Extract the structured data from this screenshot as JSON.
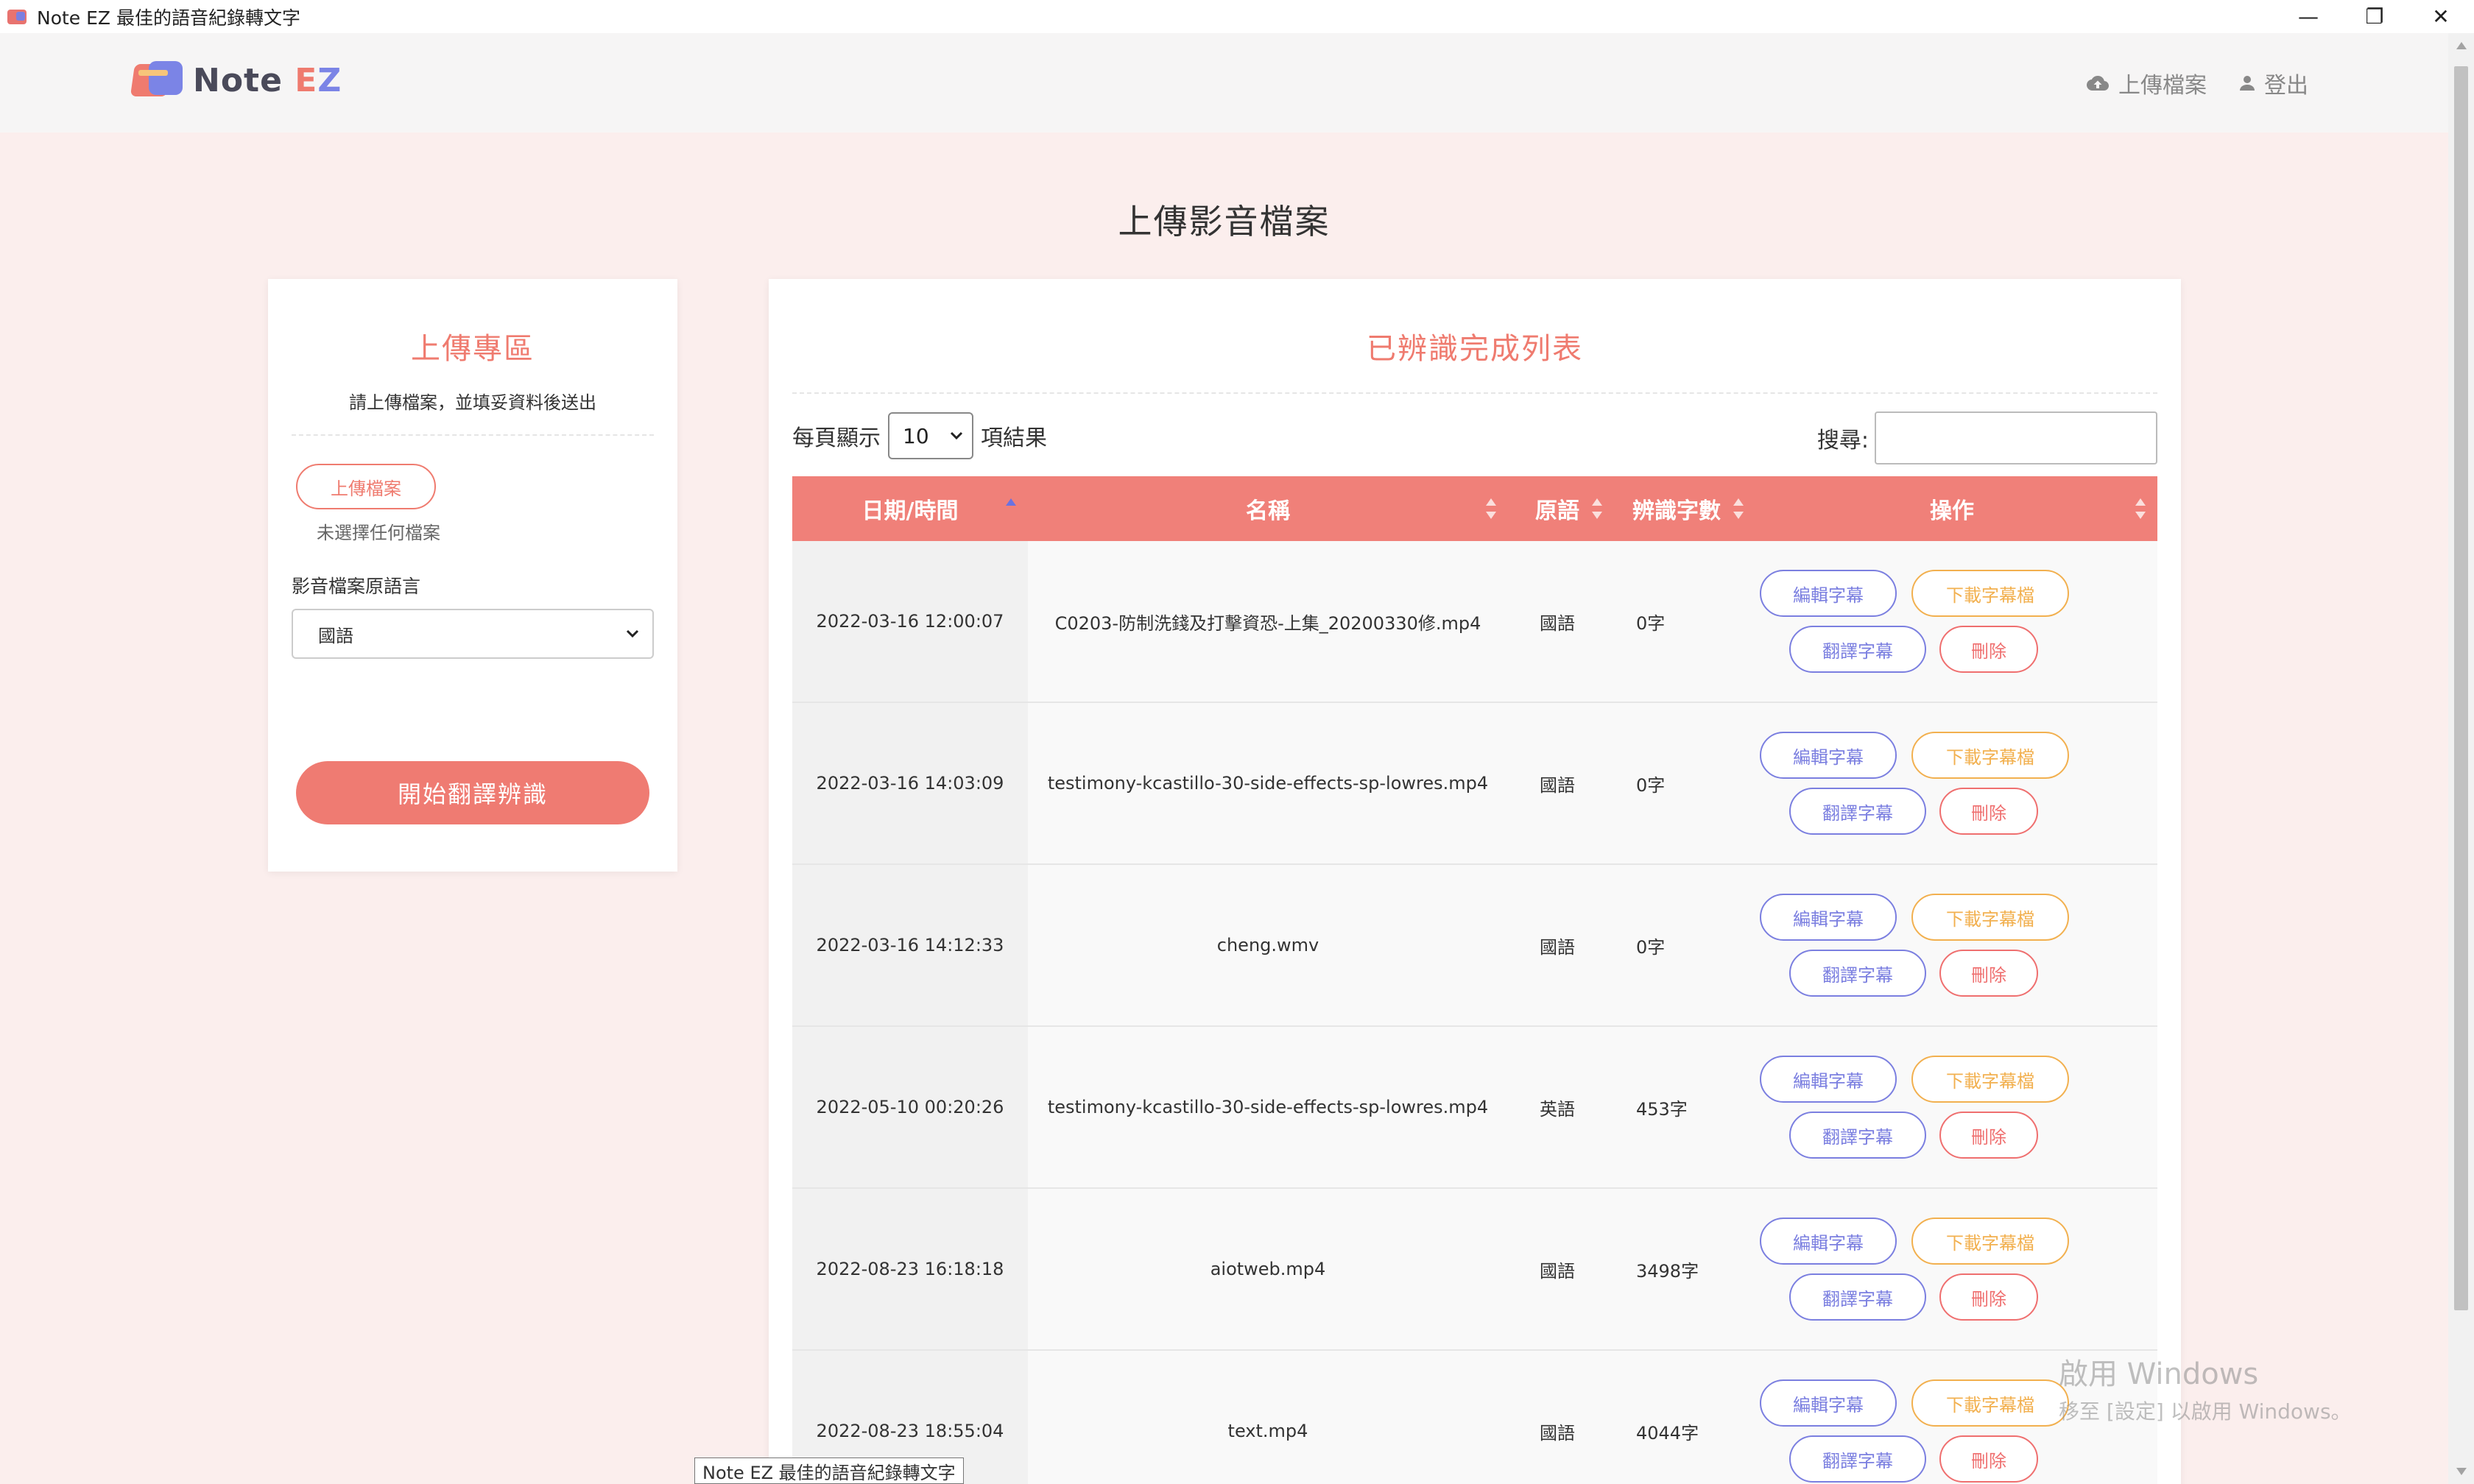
{
  "window": {
    "title": "Note EZ 最佳的語音紀錄轉文字",
    "minimize": "—",
    "restore": "❐",
    "close": "✕"
  },
  "header": {
    "logo_text_note": "Note ",
    "logo_text_e": "E",
    "logo_text_z": "Z",
    "nav": {
      "upload": "上傳檔案",
      "logout": "登出"
    }
  },
  "page": {
    "title": "上傳影音檔案"
  },
  "upload_panel": {
    "title": "上傳專區",
    "subtitle": "請上傳檔案，並填妥資料後送出",
    "upload_button": "上傳檔案",
    "no_file": "未選擇任何檔案",
    "language_label": "影音檔案原語言",
    "language_selected": "國語",
    "start_button": "開始翻譯辨識"
  },
  "list_panel": {
    "title": "已辨識完成列表",
    "per_page_prefix": "每頁顯示",
    "per_page_value": "10",
    "per_page_suffix": "項結果",
    "search_label": "搜尋:",
    "columns": {
      "date": "日期/時間",
      "name": "名稱",
      "lang": "原語",
      "count": "辨識字數",
      "ops": "操作"
    },
    "buttons": {
      "edit": "編輯字幕",
      "download": "下載字幕檔",
      "translate": "翻譯字幕",
      "delete": "刪除"
    },
    "rows": [
      {
        "date": "2022-03-16 12:00:07",
        "name": "C0203-防制洗錢及打擊資恐-上集_20200330修.mp4",
        "lang": "國語",
        "count": "0字"
      },
      {
        "date": "2022-03-16 14:03:09",
        "name": "testimony-kcastillo-30-side-effects-sp-lowres.mp4",
        "lang": "國語",
        "count": "0字"
      },
      {
        "date": "2022-03-16 14:12:33",
        "name": "cheng.wmv",
        "lang": "國語",
        "count": "0字"
      },
      {
        "date": "2022-05-10 00:20:26",
        "name": "testimony-kcastillo-30-side-effects-sp-lowres.mp4",
        "lang": "英語",
        "count": "453字"
      },
      {
        "date": "2022-08-23 16:18:18",
        "name": "aiotweb.mp4",
        "lang": "國語",
        "count": "3498字"
      },
      {
        "date": "2022-08-23 18:55:04",
        "name": "text.mp4",
        "lang": "國語",
        "count": "4044字"
      }
    ]
  },
  "watermark": {
    "line1": "啟用 Windows",
    "line2": "移至 [設定] 以啟用 Windows。"
  },
  "tooltip": "Note EZ 最佳的語音紀錄轉文字",
  "colors": {
    "accent": "#ef7b6f",
    "purple": "#7b7fe0",
    "orange": "#f2b04f",
    "background": "#fbeeed"
  }
}
